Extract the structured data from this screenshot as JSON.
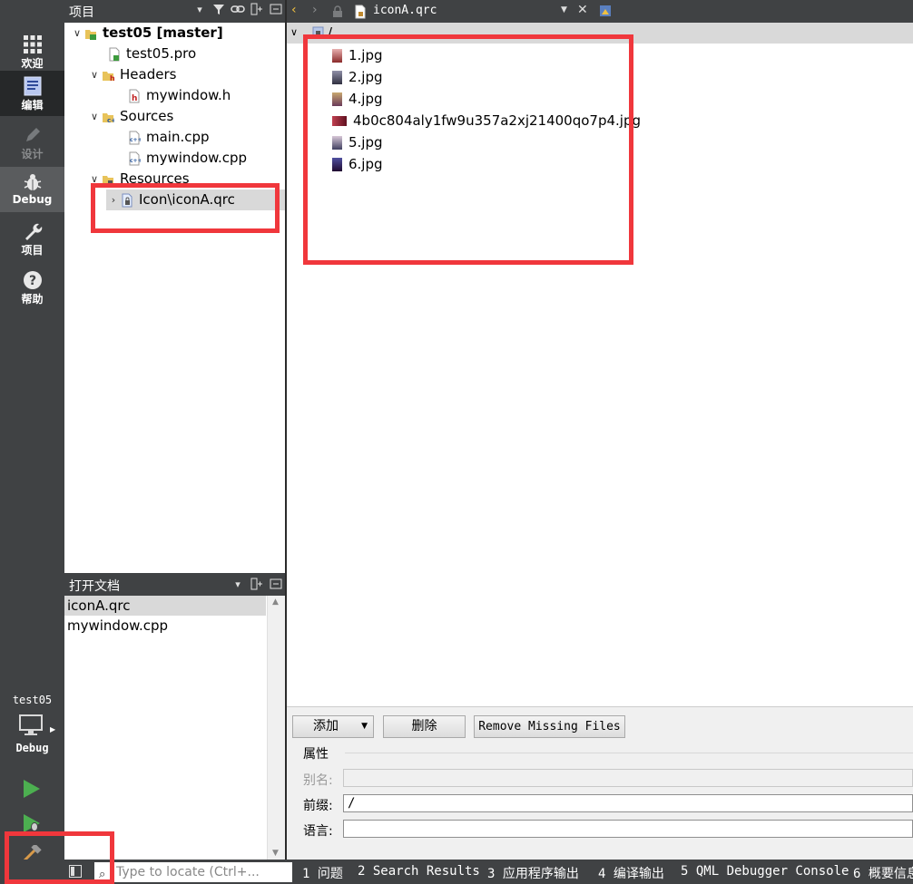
{
  "modebar": {
    "modes": [
      {
        "label": "欢迎",
        "icon": "grid-icon"
      },
      {
        "label": "编辑",
        "icon": "edit-doc-icon"
      },
      {
        "label": "设计",
        "icon": "pencil-icon"
      },
      {
        "label": "Debug",
        "icon": "bug-icon"
      },
      {
        "label": "项目",
        "icon": "wrench-icon"
      },
      {
        "label": "帮助",
        "icon": "help-icon"
      }
    ],
    "kit_project": "test05",
    "kit_mode": "Debug"
  },
  "project_pane": {
    "title": "项目",
    "tree": {
      "root": "test05 [master]",
      "pro_file": "test05.pro",
      "headers_label": "Headers",
      "header_file": "mywindow.h",
      "sources_label": "Sources",
      "source_files": [
        "main.cpp",
        "mywindow.cpp"
      ],
      "resources_label": "Resources",
      "resource_file": "Icon\\iconA.qrc"
    }
  },
  "open_docs": {
    "title": "打开文档",
    "items": [
      "iconA.qrc",
      "mywindow.cpp"
    ]
  },
  "editor": {
    "file_name": "iconA.qrc",
    "prefix": "/",
    "files": [
      "1.jpg",
      "2.jpg",
      "4.jpg",
      "4b0c804aly1fw9u357a2xj21400qo7p4.jpg",
      "5.jpg",
      "6.jpg"
    ]
  },
  "resource_controls": {
    "add_label": "添加",
    "remove_label": "删除",
    "remove_missing_label": "Remove Missing Files",
    "properties_title": "属性",
    "alias_label": "别名:",
    "alias_value": "",
    "prefix_label": "前缀:",
    "prefix_value": "/",
    "language_label": "语言:",
    "language_value": ""
  },
  "statusbar": {
    "locator_placeholder": "Type to locate (Ctrl+...",
    "output_tabs": [
      "1 问题",
      "2 Search Results",
      "3 应用程序输出",
      "4 编译输出",
      "5 QML Debugger Console",
      "6 概要信息"
    ]
  },
  "colors": {
    "sidebar": "#404244",
    "selection": "#d9d9d9",
    "annotation_red": "#f0373c",
    "run_green": "#4caf50"
  }
}
